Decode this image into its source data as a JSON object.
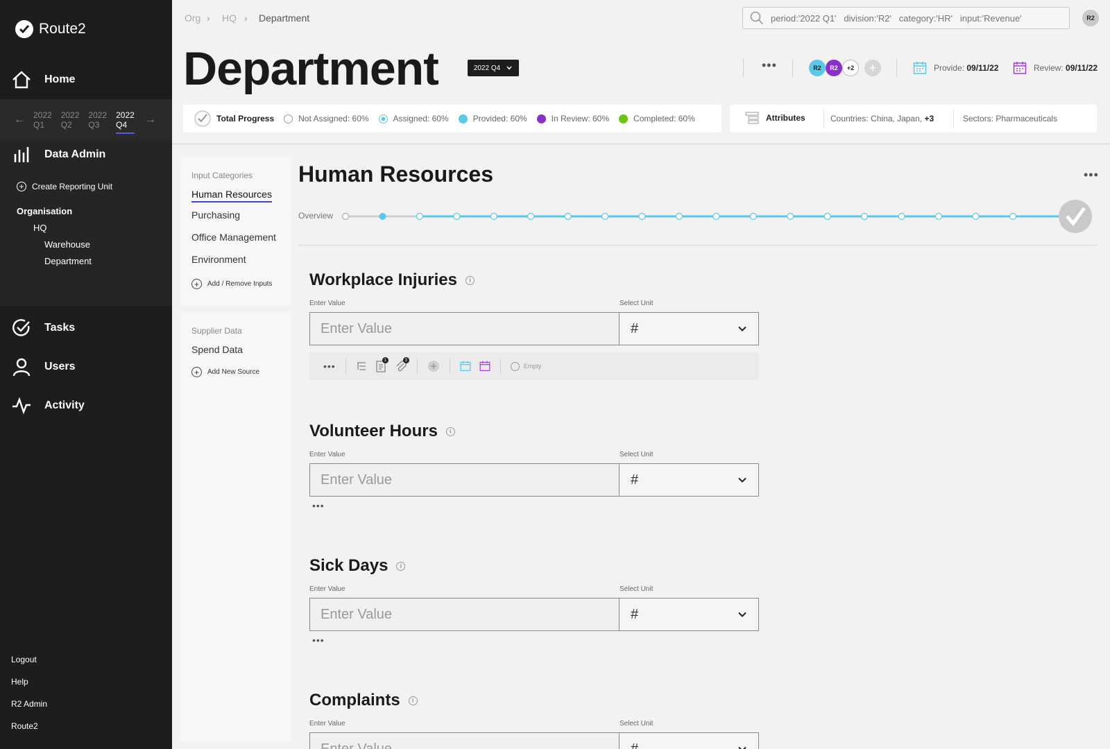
{
  "app": {
    "brand": "Route2"
  },
  "sidebar": {
    "home": "Home",
    "quarters": [
      {
        "year": "2022",
        "q": "Q1",
        "active": false
      },
      {
        "year": "2022",
        "q": "Q2",
        "active": false
      },
      {
        "year": "2022",
        "q": "Q3",
        "active": false
      },
      {
        "year": "2022",
        "q": "Q4",
        "active": true
      }
    ],
    "data_admin": "Data Admin",
    "create_unit": "Create Reporting Unit",
    "tree": {
      "root": "Organisation",
      "hq": "HQ",
      "warehouse": "Warehouse",
      "department": "Department"
    },
    "tasks": "Tasks",
    "users": "Users",
    "activity": "Activity",
    "bottom": [
      "Logout",
      "Help",
      "R2 Admin",
      "Route2"
    ]
  },
  "breadcrumb": [
    "Org",
    "HQ",
    "Department"
  ],
  "search": {
    "placeholder": "period:'2022 Q1'   division:'R2'   category:'HR'   input:'Revenue'"
  },
  "user_avatar": "R2",
  "page": {
    "title": "Department",
    "period": "2022 Q4",
    "avatars": [
      "R2",
      "R2"
    ],
    "avatars_more": "+2",
    "provide_label": "Provide:",
    "provide_date": "09/11/22",
    "review_label": "Review:",
    "review_date": "09/11/22"
  },
  "progress": {
    "total": "Total Progress",
    "items": [
      {
        "label": "Not Assigned: 60%",
        "color": "#ffffff",
        "kind": "ring"
      },
      {
        "label": "Assigned: 60%",
        "color": "#5bc8e8",
        "kind": "target"
      },
      {
        "label": "Provided: 60%",
        "color": "#5bc8e8",
        "kind": "dot"
      },
      {
        "label": "In Review: 60%",
        "color": "#8b2fc9",
        "kind": "dot"
      },
      {
        "label": "Completed: 60%",
        "color": "#6cc417",
        "kind": "dot"
      }
    ]
  },
  "attributes": {
    "title": "Attributes",
    "countries_label": "Countries:",
    "countries": "China, Japan,",
    "countries_more": "+3",
    "sectors_label": "Sectors:",
    "sectors": "Pharmaceuticals"
  },
  "categories": {
    "header": "Input Categories",
    "items": [
      "Human Resources",
      "Purchasing",
      "Office Management",
      "Environment"
    ],
    "add": "Add / Remove Inputs"
  },
  "supplier": {
    "header": "Supplier Data",
    "items": [
      "Spend Data"
    ],
    "add": "Add New Source"
  },
  "section": {
    "title": "Human Resources",
    "overview": "Overview"
  },
  "timeline": {
    "total_steps": 20,
    "current_step": 2,
    "accent": "#5bc8e8"
  },
  "inputs": [
    {
      "title": "Workplace Injuries",
      "value_label": "Enter Value",
      "unit_label": "Select Unit",
      "placeholder": "Enter Value",
      "unit": "#",
      "status": "Empty",
      "badges": [
        "1",
        "3"
      ]
    },
    {
      "title": "Volunteer Hours",
      "value_label": "Enter Value",
      "unit_label": "Select Unit",
      "placeholder": "Enter Value",
      "unit": "#"
    },
    {
      "title": "Sick Days",
      "value_label": "Enter Value",
      "unit_label": "Select Unit",
      "placeholder": "Enter Value",
      "unit": "#"
    },
    {
      "title": "Complaints",
      "value_label": "Enter Value",
      "unit_label": "Select Unit",
      "placeholder": "Enter Value",
      "unit": "#"
    }
  ]
}
